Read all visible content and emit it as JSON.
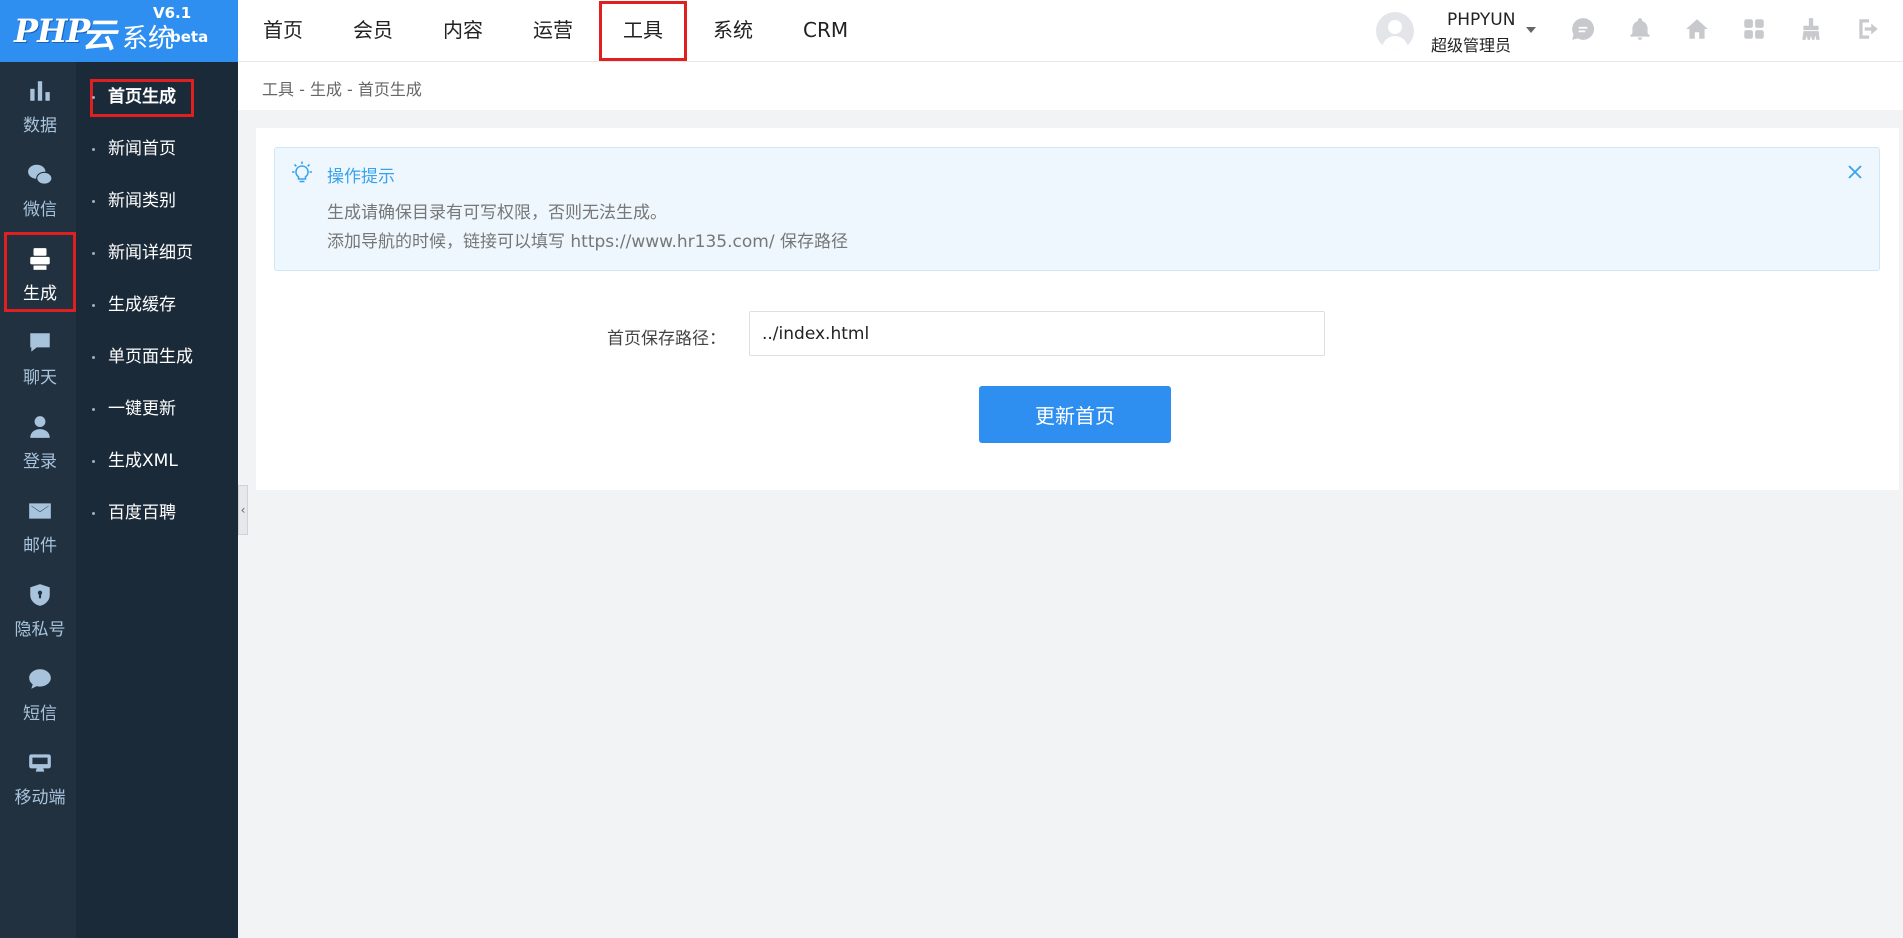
{
  "logo": {
    "brand": "PHP",
    "yun": "云",
    "system": "系统",
    "version": "V6.1",
    "beta": "beta"
  },
  "topnav": [
    {
      "label": "首页"
    },
    {
      "label": "会员"
    },
    {
      "label": "内容"
    },
    {
      "label": "运营"
    },
    {
      "label": "工具",
      "active": true
    },
    {
      "label": "系统"
    },
    {
      "label": "CRM"
    }
  ],
  "user": {
    "name": "PHPYUN",
    "role": "超级管理员"
  },
  "top_icons": [
    "chat-icon",
    "bell-icon",
    "home-icon",
    "apps-icon",
    "broom-icon",
    "logout-icon"
  ],
  "iconbar": [
    {
      "label": "数据",
      "icon": "bar-chart-icon"
    },
    {
      "label": "微信",
      "icon": "wechat-icon"
    },
    {
      "label": "生成",
      "icon": "printer-icon",
      "active": true
    },
    {
      "label": "聊天",
      "icon": "chat-bubble-icon"
    },
    {
      "label": "登录",
      "icon": "user-icon"
    },
    {
      "label": "邮件",
      "icon": "mail-icon"
    },
    {
      "label": "隐私号",
      "icon": "shield-icon"
    },
    {
      "label": "短信",
      "icon": "message-icon"
    },
    {
      "label": "移动端",
      "icon": "mobile-icon"
    }
  ],
  "subnav": [
    {
      "label": "首页生成",
      "active": true
    },
    {
      "label": "新闻首页"
    },
    {
      "label": "新闻类别"
    },
    {
      "label": "新闻详细页"
    },
    {
      "label": "生成缓存"
    },
    {
      "label": "单页面生成"
    },
    {
      "label": "一键更新"
    },
    {
      "label": "生成XML"
    },
    {
      "label": "百度百聘"
    }
  ],
  "breadcrumb": "工具 - 生成 - 首页生成",
  "tips": {
    "title": "操作提示",
    "line1": "生成请确保目录有可写权限，否则无法生成。",
    "line2": "添加导航的时候，链接可以填写 https://www.hr135.com/ 保存路径"
  },
  "form": {
    "path_label": "首页保存路径：",
    "path_value": "../index.html",
    "submit_label": "更新首页"
  },
  "colors": {
    "accent": "#2e8ff0",
    "sidebar": "#22313f",
    "subbar": "#1b2a39",
    "highlight": "#e02020"
  }
}
